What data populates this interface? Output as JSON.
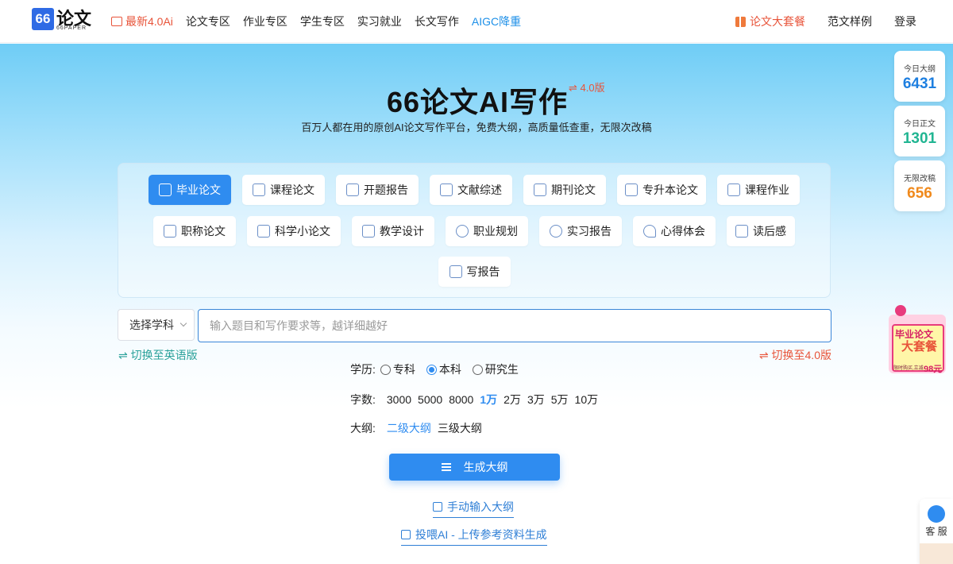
{
  "header": {
    "logo_box": "66",
    "logo_text": "论文",
    "logo_sub": "66PAPER",
    "nav": [
      {
        "label": "最新4.0Ai",
        "type": "hot"
      },
      {
        "label": "论文专区"
      },
      {
        "label": "作业专区"
      },
      {
        "label": "学生专区"
      },
      {
        "label": "实习就业"
      },
      {
        "label": "长文写作"
      },
      {
        "label": "AIGC降重",
        "type": "aigc"
      }
    ],
    "package": "论文大套餐",
    "samples": "范文样例",
    "login": "登录"
  },
  "hero": {
    "title": "66论文AI写作",
    "version": "⇌ 4.0版",
    "subtitle": "百万人都在用的原创AI论文写作平台，免费大纲，高质量低查重，无限次改稿"
  },
  "categories": [
    {
      "label": "毕业论文",
      "active": true
    },
    {
      "label": "课程论文"
    },
    {
      "label": "开题报告"
    },
    {
      "label": "文献综述"
    },
    {
      "label": "期刊论文"
    },
    {
      "label": "专升本论文"
    },
    {
      "label": "课程作业"
    },
    {
      "label": "职称论文"
    },
    {
      "label": "科学小论文"
    },
    {
      "label": "教学设计"
    },
    {
      "label": "职业规划"
    },
    {
      "label": "实习报告"
    },
    {
      "label": "心得体会"
    },
    {
      "label": "读后感"
    },
    {
      "label": "写报告"
    }
  ],
  "form": {
    "subject": "选择学科",
    "topic_placeholder": "输入题目和写作要求等，越详细越好",
    "switch_en": "⇌ 切换至英语版",
    "switch_40": "⇌ 切换至4.0版",
    "education_label": "学历:",
    "education": [
      {
        "label": "专科",
        "checked": false
      },
      {
        "label": "本科",
        "checked": true
      },
      {
        "label": "研究生",
        "checked": false
      }
    ],
    "words_label": "字数:",
    "words": [
      "3000",
      "5000",
      "8000",
      "1万",
      "2万",
      "3万",
      "5万",
      "10万"
    ],
    "words_selected": "1万",
    "outline_label": "大纲:",
    "outline": [
      "二级大纲",
      "三级大纲"
    ],
    "outline_selected": "二级大纲",
    "generate": "生成大纲",
    "manual": "手动输入大纲",
    "upload": "投喂AI - 上传参考资料生成"
  },
  "stats": [
    {
      "label": "今日大纲",
      "value": "6431",
      "color": "#1e7fe0"
    },
    {
      "label": "今日正文",
      "value": "1301",
      "color": "#21b592"
    },
    {
      "label": "无限改稿",
      "value": "656",
      "color": "#f08a1d"
    }
  ],
  "promo": {
    "line1": "毕业论文",
    "line2": "大套餐",
    "line3": "限时购买,立减",
    "price": "98元"
  },
  "service": {
    "label": "客 服"
  }
}
